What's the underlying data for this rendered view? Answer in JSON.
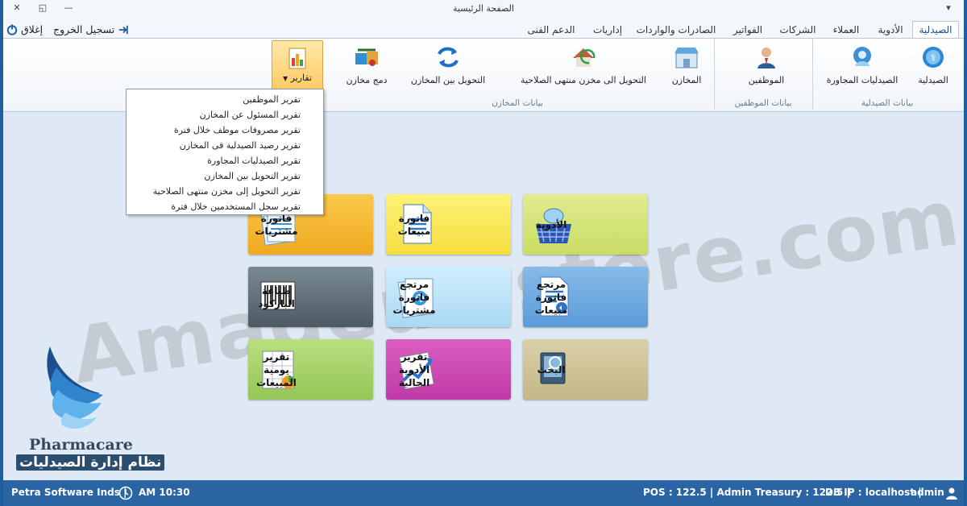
{
  "window": {
    "title": "الصفحة الرئيسية",
    "close_glyph": "✕",
    "restore_glyph": "◱",
    "minimize_glyph": "—"
  },
  "tabs": [
    {
      "label": "الصيدلية",
      "active": true
    },
    {
      "label": "الأدوية"
    },
    {
      "label": "العملاء"
    },
    {
      "label": "الشركات"
    },
    {
      "label": "الفواتير"
    },
    {
      "label": "الصادرات والواردات"
    },
    {
      "label": "إداريات"
    },
    {
      "label": "الدعم الفنى"
    }
  ],
  "header_actions": {
    "logout": "تسجيل الخروج",
    "close": "إغلاق"
  },
  "ribbon": {
    "pharmacy": "الصيدلية",
    "neighbor_pharmacies": "الصيدليات المجاورة",
    "employees": "الموظفين",
    "stores": "المخازن",
    "transfer_expired": "التحويل الى مخزن منتهى الصلاحية",
    "transfer_between": "التحويل بين المخازن",
    "merge_stores": "دمج مخازن",
    "reports": "تقارير",
    "group_pharmacy": "بيانات الصيدلية",
    "group_employees": "بيانات الموظفين",
    "group_stores": "بيانات المخازن"
  },
  "reports_menu": [
    "تقرير الموظفين",
    "تقرير المسئول عن المخازن",
    "تقرير مصروفات موظف خلال فترة",
    "تقرير رصيد الصيدلية فى المخازن",
    "تقرير الصيدليات المجاورة",
    "تقرير التحويل بين المخازن",
    "تقرير التحويل إلى مخزن منتهى الصلاحية",
    "تقرير سجل المستخدمين خلال فترة"
  ],
  "tiles": [
    {
      "label": "فاتورة مشتريات",
      "color": "#f6b830",
      "icon": "purchase-invoice-icon"
    },
    {
      "label": "فاتورة مبيعات",
      "color": "#fbe95c",
      "icon": "sales-invoice-icon"
    },
    {
      "label": "الأدوية",
      "color": "#d8e77c",
      "icon": "medicines-basket-icon"
    },
    {
      "label": "طباعة الباركود",
      "color": "#5d6d77",
      "icon": "barcode-icon"
    },
    {
      "label": "مرتجع فاتورة مشتريات",
      "color": "#bfe3f8",
      "icon": "purchase-return-icon"
    },
    {
      "label": "مرتجع فاتورة مبيعات",
      "color": "#6fa9e0",
      "icon": "sales-return-icon"
    },
    {
      "label": "تقرير يومية المبيعات",
      "color": "#a7d56a",
      "icon": "daily-sales-report-icon"
    },
    {
      "label": "تقرير الأدوية الحالية",
      "color": "#d04ab5",
      "icon": "current-medicines-report-icon"
    },
    {
      "label": "البحث",
      "color": "#cfc49a",
      "icon": "search-icon"
    }
  ],
  "watermark": "Amadeus-store.com",
  "brand": {
    "name": "Pharmacare",
    "subtitle": "نظام إدارة الصيدليات"
  },
  "status": {
    "company": "Petra Software Inds |",
    "time": "AM 10:30",
    "pos": "POS : 122.5 | Admin Treasury : 122.5 |",
    "db": "DB IP : localhost |",
    "user": "admin"
  }
}
